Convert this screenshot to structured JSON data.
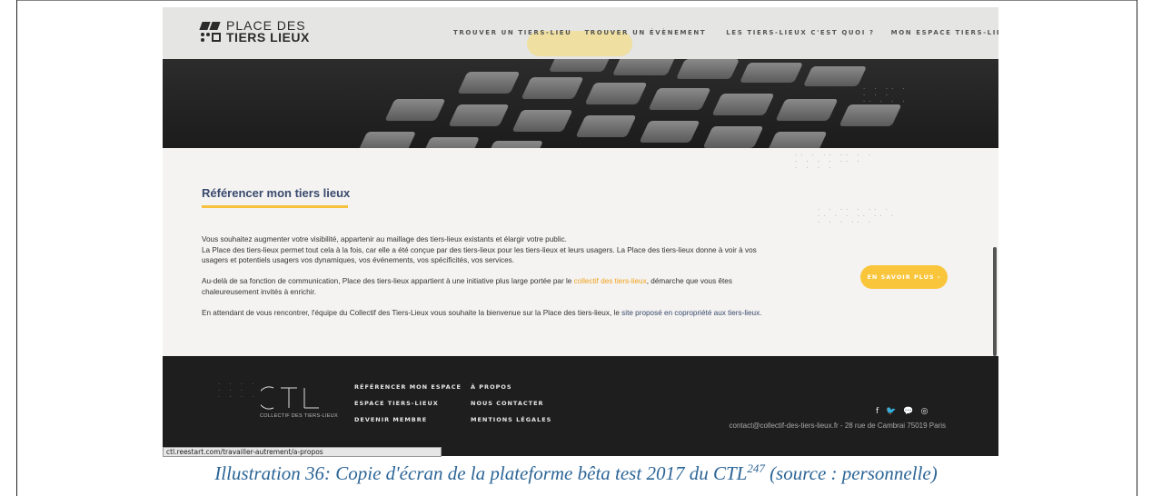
{
  "header": {
    "logo_line1": "PLACE DES",
    "logo_line2": "TIERS LIEUX",
    "nav": [
      "TROUVER UN TIERS-LIEU",
      "TROUVER UN ÉVÈNEMENT",
      "LES TIERS-LIEUX C'EST QUOI ?",
      "MON ESPACE TIERS-LIEUX"
    ]
  },
  "main": {
    "title": "Référencer mon tiers lieux",
    "p1_line1": "Vous souhaitez augmenter votre visibilité, appartenir au maillage des tiers-lieux existants et élargir votre public.",
    "p1_line2": "La Place des tiers-lieux permet tout cela à la fois, car elle a été conçue par des tiers-lieux pour les tiers-lieux et leurs usagers. La Place des tiers-lieux donne à voir à vos usagers et potentiels usagers vos dynamiques, vos événements, vos spécificités, vos services.",
    "p2_before": "Au-delà de sa fonction de communication, Place des tiers-lieux appartient à une initiative plus large portée par le ",
    "p2_link": "collectif des tiers-lieux",
    "p2_after": ", démarche que vous êtes chaleureusement invités à enrichir.",
    "p3_before": "En attendant de vous rencontrer, l'équipe du Collectif des Tiers-Lieux vous souhaite la bienvenue sur la Place des tiers-lieux, le ",
    "p3_link": "site proposé en copropriété aux tiers-lieux.",
    "cta": "EN SAVOIR PLUS ›"
  },
  "footer": {
    "logo_caption": "COLLECTIF DES TIERS-LIEUX",
    "col1": [
      "RÉFÉRENCER MON ESPACE",
      "ESPACE TIERS-LIEUX",
      "DEVENIR MEMBRE"
    ],
    "col2": [
      "À PROPOS",
      "NOUS CONTACTER",
      "MENTIONS LÉGALES"
    ],
    "social": [
      "f",
      "🐦",
      "💬",
      "◎"
    ],
    "contact": "contact@collectif-des-tiers-lieux.fr - 28 rue de Cambrai 75019 Paris"
  },
  "status_url": "ctl.reestart.com/travailler-autrement/a-propos",
  "caption": {
    "text": "Illustration 36: Copie d'écran de la plateforme bêta test 2017 du CTL",
    "sup": "247",
    "after": " (source : personnelle)"
  },
  "colors": {
    "accent": "#f9c53b",
    "title": "#3a4a6e",
    "footer_bg": "#1e1e1e",
    "caption": "#2c6596"
  }
}
